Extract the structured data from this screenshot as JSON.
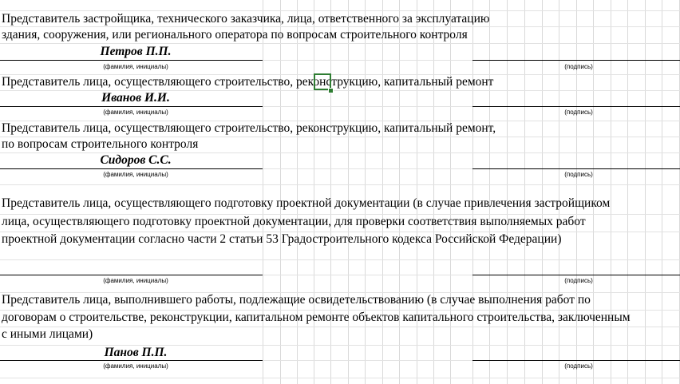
{
  "blocks": [
    {
      "lines": [
        "Представитель застройщика, технического заказчика, лица, ответственного за эксплуатацию",
        "здания, сооружения, или регионального оператора по вопросам строительного контроля"
      ],
      "name": "Петров П.П.",
      "fio_caption": "(фамилия, инициалы)",
      "sign_caption": "(подпись)"
    },
    {
      "lines": [
        "Представитель лица, осуществляющего строительство, реконструкцию, капитальный ремонт"
      ],
      "name": "Иванов И.И.",
      "fio_caption": "(фамилия, инициалы)",
      "sign_caption": "(подпись)"
    },
    {
      "lines": [
        "Представитель лица, осуществляющего строительство, реконструкцию, капитальный ремонт,",
        "по вопросам строительного контроля"
      ],
      "name": "Сидоров С.С.",
      "fio_caption": "(фамилия, инициалы)",
      "sign_caption": "(подпись)"
    },
    {
      "lines": [
        "Представитель лица, осуществляющего подготовку проектной документации (в случае привлечения застройщиком",
        "лица, осуществляющего подготовку проектной документации, для проверки соответствия выполняемых работ",
        "проектной документации  согласно части 2 статьи 53 Градостроительного кодекса Российской Федерации)"
      ],
      "name": "",
      "fio_caption": "(фамилия, инициалы)",
      "sign_caption": "(подпись)"
    },
    {
      "lines": [
        "Представитель лица, выполнившего работы, подлежащие освидетельствованию (в случае выполнения работ по",
        "договорам о строительстве, реконструкции, капитальном ремонте объектов капитального строительства, заключенным",
        "с иными лицами)"
      ],
      "name": "Панов П.П.",
      "fio_caption": "(фамилия, инициалы)",
      "sign_caption": "(подпись)"
    }
  ]
}
